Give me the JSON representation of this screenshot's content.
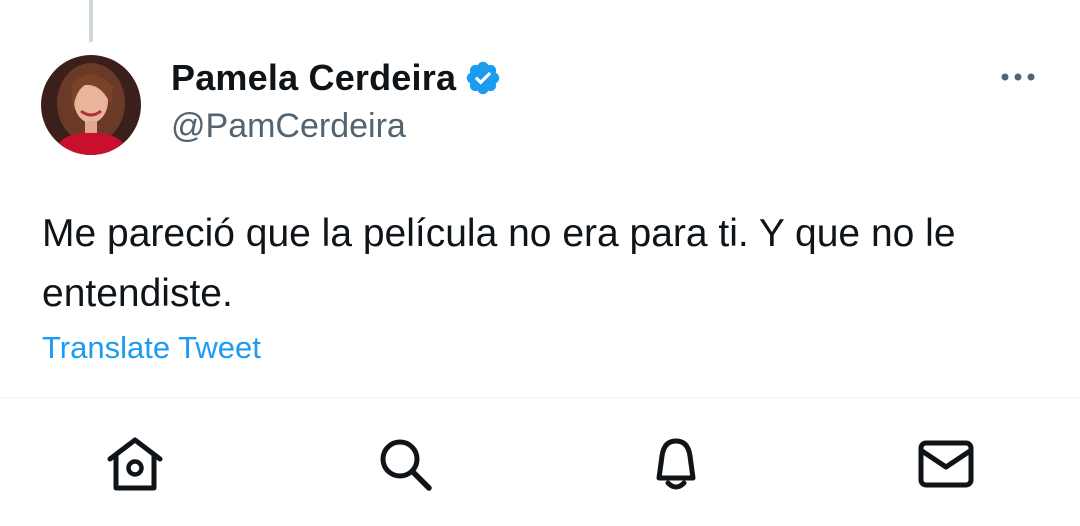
{
  "tweet": {
    "author": {
      "display_name": "Pamela Cerdeira",
      "handle": "@PamCerdeira",
      "verified": true
    },
    "text": "Me pareció que la película no era para ti. Y que no le entendiste.",
    "translate_label": "Translate Tweet"
  },
  "bottom_nav": {
    "items": [
      {
        "icon": "home-icon"
      },
      {
        "icon": "search-icon"
      },
      {
        "icon": "bell-icon"
      },
      {
        "icon": "mail-icon"
      }
    ]
  },
  "colors": {
    "accent": "#1d9bf0",
    "verified_badge": "#1d9bf0",
    "text_primary": "#0f1419",
    "text_secondary": "#536471",
    "divider": "#eff3f4"
  }
}
